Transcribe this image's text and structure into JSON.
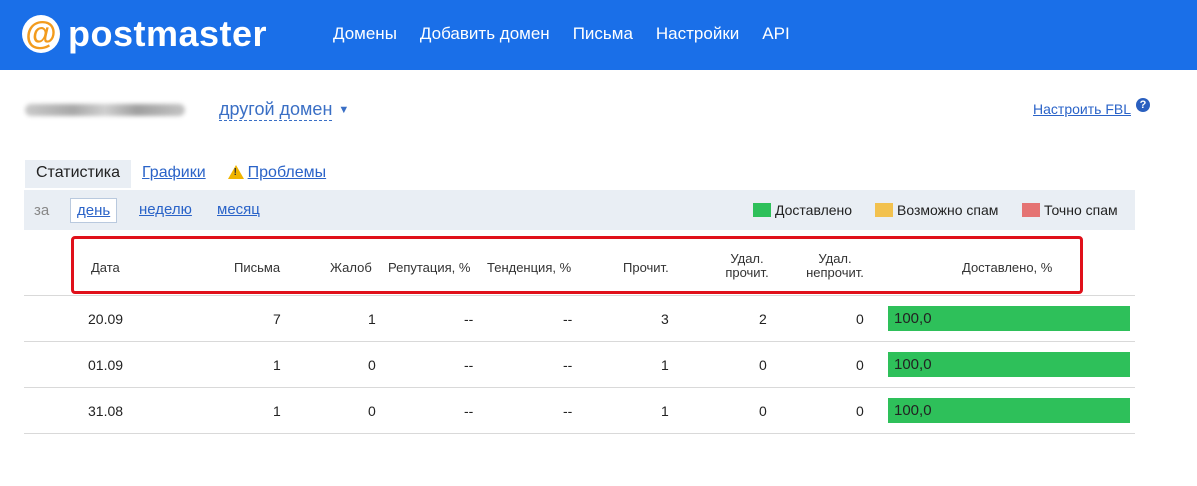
{
  "header": {
    "logo_symbol": "@",
    "logo_text": "postmaster",
    "nav": [
      "Домены",
      "Добавить домен",
      "Письма",
      "Настройки",
      "API"
    ]
  },
  "domain": {
    "other_domain": "другой домен",
    "fbl_link": "Настроить FBL",
    "help_symbol": "?"
  },
  "tabs": {
    "stats": "Статистика",
    "charts": "Графики",
    "problems": "Проблемы"
  },
  "filter": {
    "label": "за",
    "day": "день",
    "week": "неделю",
    "month": "месяц"
  },
  "legend": [
    {
      "label": "Доставлено",
      "color": "#2ec05a"
    },
    {
      "label": "Возможно спам",
      "color": "#f2c14e"
    },
    {
      "label": "Точно спам",
      "color": "#e57373"
    }
  ],
  "table": {
    "headers": {
      "date": "Дата",
      "letters": "Письма",
      "complaints": "Жалоб",
      "reputation": "Репутация, %",
      "trend": "Тенденция, %",
      "read": "Прочит.",
      "del_read_1": "Удал.",
      "del_read_2": "прочит.",
      "del_unread_1": "Удал.",
      "del_unread_2": "непрочит.",
      "delivered": "Доставлено, %"
    },
    "rows": [
      {
        "date": "20.09",
        "letters": "7",
        "complaints": "1",
        "reputation": "--",
        "trend": "--",
        "read": "3",
        "del_read": "2",
        "del_unread": "0",
        "delivered": "100,0"
      },
      {
        "date": "01.09",
        "letters": "1",
        "complaints": "0",
        "reputation": "--",
        "trend": "--",
        "read": "1",
        "del_read": "0",
        "del_unread": "0",
        "delivered": "100,0"
      },
      {
        "date": "31.08",
        "letters": "1",
        "complaints": "0",
        "reputation": "--",
        "trend": "--",
        "read": "1",
        "del_read": "0",
        "del_unread": "0",
        "delivered": "100,0"
      }
    ]
  }
}
